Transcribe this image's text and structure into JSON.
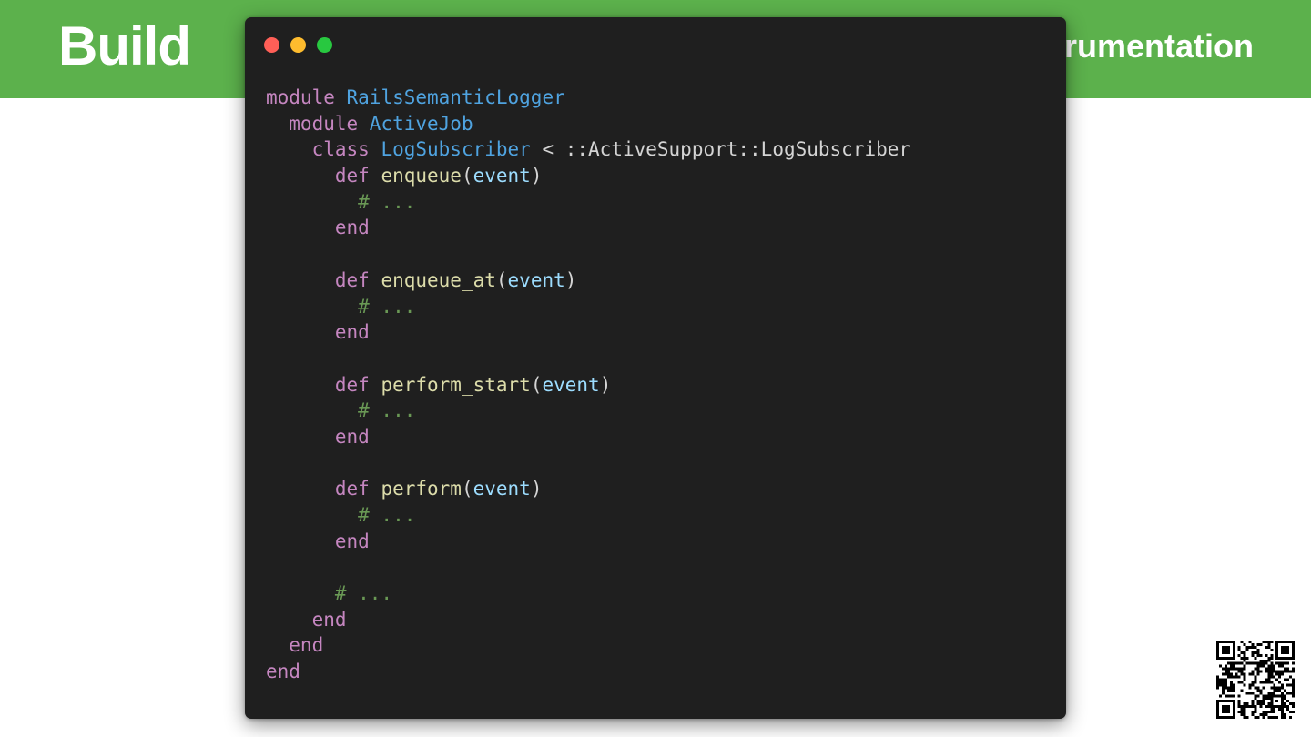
{
  "slide": {
    "title_left": "Build",
    "title_right": "rumentation"
  },
  "window": {
    "controls": [
      "close",
      "minimize",
      "maximize"
    ]
  },
  "code": {
    "language": "ruby",
    "lines": [
      [
        {
          "t": "module ",
          "c": "kw"
        },
        {
          "t": "RailsSemanticLogger",
          "c": "cls"
        }
      ],
      [
        {
          "t": "  module ",
          "c": "kw"
        },
        {
          "t": "ActiveJob",
          "c": "cls"
        }
      ],
      [
        {
          "t": "    class ",
          "c": "kw"
        },
        {
          "t": "LogSubscriber",
          "c": "cls"
        },
        {
          "t": " < ::ActiveSupport::LogSubscriber",
          "c": "plain"
        }
      ],
      [
        {
          "t": "      def ",
          "c": "kw"
        },
        {
          "t": "enqueue",
          "c": "fn"
        },
        {
          "t": "(",
          "c": "plain"
        },
        {
          "t": "event",
          "c": "param"
        },
        {
          "t": ")",
          "c": "plain"
        }
      ],
      [
        {
          "t": "        # ...",
          "c": "cmt"
        }
      ],
      [
        {
          "t": "      end",
          "c": "kw"
        }
      ],
      [],
      [
        {
          "t": "      def ",
          "c": "kw"
        },
        {
          "t": "enqueue_at",
          "c": "fn"
        },
        {
          "t": "(",
          "c": "plain"
        },
        {
          "t": "event",
          "c": "param"
        },
        {
          "t": ")",
          "c": "plain"
        }
      ],
      [
        {
          "t": "        # ...",
          "c": "cmt"
        }
      ],
      [
        {
          "t": "      end",
          "c": "kw"
        }
      ],
      [],
      [
        {
          "t": "      def ",
          "c": "kw"
        },
        {
          "t": "perform_start",
          "c": "fn"
        },
        {
          "t": "(",
          "c": "plain"
        },
        {
          "t": "event",
          "c": "param"
        },
        {
          "t": ")",
          "c": "plain"
        }
      ],
      [
        {
          "t": "        # ...",
          "c": "cmt"
        }
      ],
      [
        {
          "t": "      end",
          "c": "kw"
        }
      ],
      [],
      [
        {
          "t": "      def ",
          "c": "kw"
        },
        {
          "t": "perform",
          "c": "fn"
        },
        {
          "t": "(",
          "c": "plain"
        },
        {
          "t": "event",
          "c": "param"
        },
        {
          "t": ")",
          "c": "plain"
        }
      ],
      [
        {
          "t": "        # ...",
          "c": "cmt"
        }
      ],
      [
        {
          "t": "      end",
          "c": "kw"
        }
      ],
      [],
      [
        {
          "t": "      # ...",
          "c": "cmt"
        }
      ],
      [
        {
          "t": "    end",
          "c": "kw"
        }
      ],
      [
        {
          "t": "  end",
          "c": "kw"
        }
      ],
      [
        {
          "t": "end",
          "c": "kw"
        }
      ]
    ]
  },
  "colors": {
    "header_band": "#5cb14c",
    "editor_background": "#1f1f1f",
    "keyword": "#c586c0",
    "class_name": "#4fa3e0",
    "function_name": "#dcdcaa",
    "parameter": "#9cdcfe",
    "comment": "#6a9955"
  },
  "qr_code": {
    "icon": "qr-code-icon"
  }
}
